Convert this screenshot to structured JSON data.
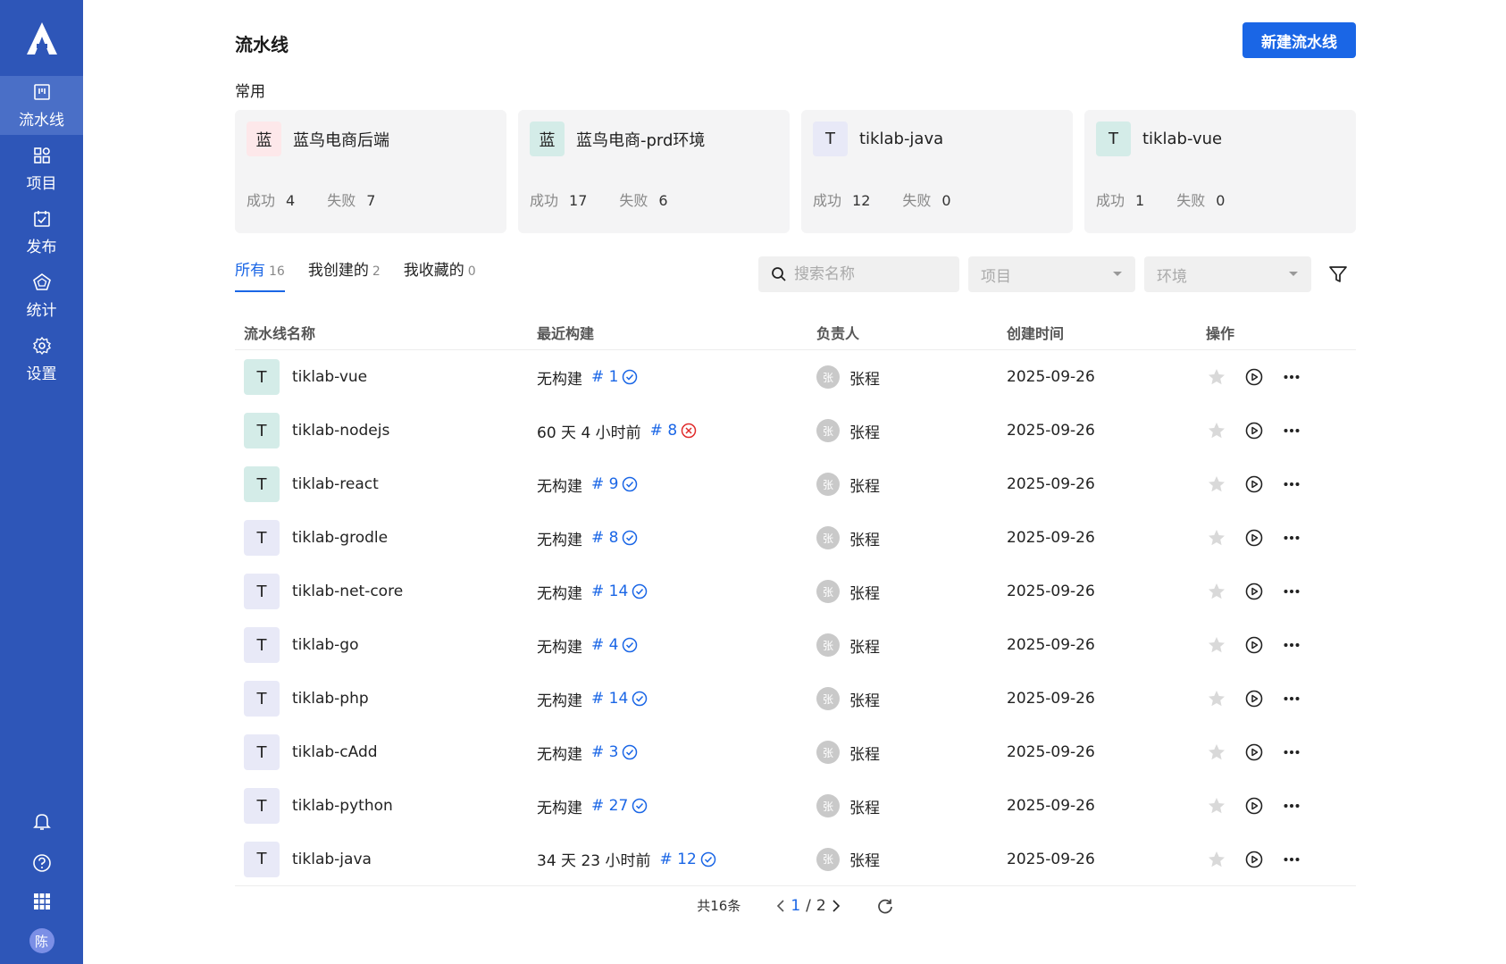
{
  "sidebar": {
    "logo": "A",
    "items": [
      {
        "label": "流水线",
        "icon": "pipeline-icon",
        "active": true
      },
      {
        "label": "项目",
        "icon": "project-grid-icon",
        "active": false
      },
      {
        "label": "发布",
        "icon": "calendar-check-icon",
        "active": false
      },
      {
        "label": "统计",
        "icon": "stats-pentagon-icon",
        "active": false
      },
      {
        "label": "设置",
        "icon": "gear-icon",
        "active": false
      }
    ],
    "user_initial": "陈"
  },
  "header": {
    "title": "流水线",
    "new_button": "新建流水线"
  },
  "favorites": {
    "label": "常用",
    "success_label": "成功",
    "fail_label": "失败",
    "cards": [
      {
        "icon_text": "蓝",
        "icon_bg": "#fde8ea",
        "name": "蓝鸟电商后端",
        "success": "4",
        "fail": "7"
      },
      {
        "icon_text": "蓝",
        "icon_bg": "#d4ece8",
        "name": "蓝鸟电商-prd环境",
        "success": "17",
        "fail": "6"
      },
      {
        "icon_text": "T",
        "icon_bg": "#e8e9f7",
        "name": "tiklab-java",
        "success": "12",
        "fail": "0"
      },
      {
        "icon_text": "T",
        "icon_bg": "#d4ece8",
        "name": "tiklab-vue",
        "success": "1",
        "fail": "0"
      }
    ]
  },
  "tabs": [
    {
      "label": "所有",
      "count": "16",
      "active": true
    },
    {
      "label": "我创建的",
      "count": "2",
      "active": false
    },
    {
      "label": "我收藏的",
      "count": "0",
      "active": false
    }
  ],
  "filters": {
    "search_placeholder": "搜索名称",
    "project_placeholder": "项目",
    "env_placeholder": "环境"
  },
  "table": {
    "headers": [
      "流水线名称",
      "最近构建",
      "负责人",
      "创建时间",
      "操作"
    ],
    "rows": [
      {
        "icon": "T",
        "icon_bg": "#d4ece8",
        "name": "tiklab-vue",
        "recent": "无构建",
        "build": "# 1",
        "status": "success",
        "owner_initial": "张",
        "owner": "张程",
        "created": "2025-09-26"
      },
      {
        "icon": "T",
        "icon_bg": "#d4ece8",
        "name": "tiklab-nodejs",
        "recent": "60 天 4 小时前",
        "build": "# 8",
        "status": "fail",
        "owner_initial": "张",
        "owner": "张程",
        "created": "2025-09-26"
      },
      {
        "icon": "T",
        "icon_bg": "#d4ece8",
        "name": "tiklab-react",
        "recent": "无构建",
        "build": "# 9",
        "status": "success",
        "owner_initial": "张",
        "owner": "张程",
        "created": "2025-09-26"
      },
      {
        "icon": "T",
        "icon_bg": "#e8e9f7",
        "name": "tiklab-grodle",
        "recent": "无构建",
        "build": "# 8",
        "status": "success",
        "owner_initial": "张",
        "owner": "张程",
        "created": "2025-09-26"
      },
      {
        "icon": "T",
        "icon_bg": "#e8e9f7",
        "name": "tiklab-net-core",
        "recent": "无构建",
        "build": "# 14",
        "status": "success",
        "owner_initial": "张",
        "owner": "张程",
        "created": "2025-09-26"
      },
      {
        "icon": "T",
        "icon_bg": "#e8e9f7",
        "name": "tiklab-go",
        "recent": "无构建",
        "build": "# 4",
        "status": "success",
        "owner_initial": "张",
        "owner": "张程",
        "created": "2025-09-26"
      },
      {
        "icon": "T",
        "icon_bg": "#e8e9f7",
        "name": "tiklab-php",
        "recent": "无构建",
        "build": "# 14",
        "status": "success",
        "owner_initial": "张",
        "owner": "张程",
        "created": "2025-09-26"
      },
      {
        "icon": "T",
        "icon_bg": "#e8e9f7",
        "name": "tiklab-cAdd",
        "recent": "无构建",
        "build": "# 3",
        "status": "success",
        "owner_initial": "张",
        "owner": "张程",
        "created": "2025-09-26"
      },
      {
        "icon": "T",
        "icon_bg": "#e8e9f7",
        "name": "tiklab-python",
        "recent": "无构建",
        "build": "# 27",
        "status": "success",
        "owner_initial": "张",
        "owner": "张程",
        "created": "2025-09-26"
      },
      {
        "icon": "T",
        "icon_bg": "#e8e9f7",
        "name": "tiklab-java",
        "recent": "34 天 23 小时前",
        "build": "# 12",
        "status": "success",
        "owner_initial": "张",
        "owner": "张程",
        "created": "2025-09-26"
      }
    ]
  },
  "pagination": {
    "total": "共16条",
    "current": "1",
    "separator": " / ",
    "pages": "2"
  },
  "colors": {
    "sidebar_bg": "#2e56b8",
    "accent": "#1a66e6",
    "success": "#1a66e6",
    "fail": "#e02b2b"
  }
}
